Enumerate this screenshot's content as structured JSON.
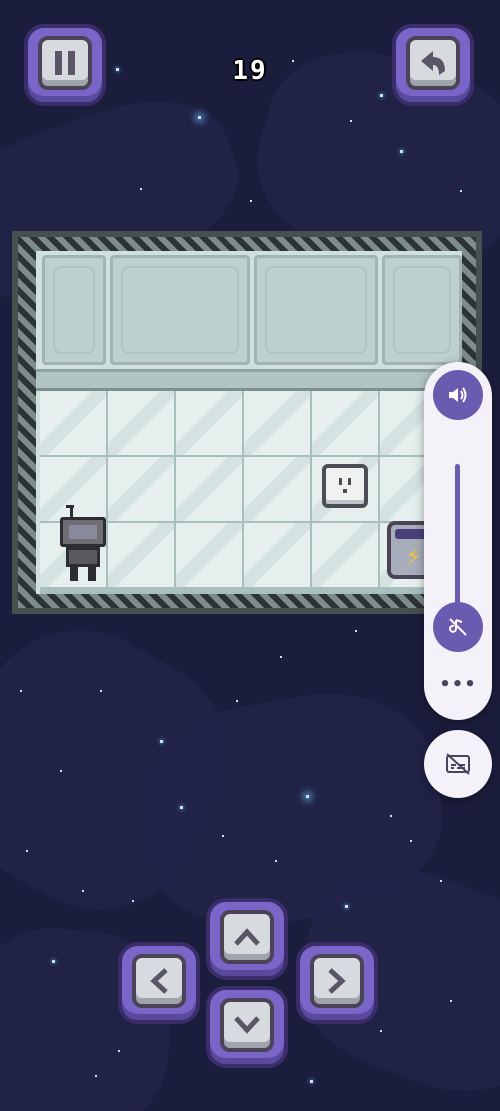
{
  "hud": {
    "score": "19",
    "pause_icon": "pause-icon",
    "undo_icon": "undo-arrow-icon"
  },
  "board": {
    "cols": 6,
    "rows": 3,
    "objects": [
      {
        "type": "robot-player",
        "icon": "robot-icon"
      },
      {
        "type": "power-outlet",
        "icon": "outlet-icon"
      },
      {
        "type": "battery-charger",
        "icon": "lightning-bolt-icon"
      }
    ]
  },
  "dpad": {
    "up_icon": "arrow-up-icon",
    "down_icon": "arrow-down-icon",
    "left_icon": "arrow-left-icon",
    "right_icon": "arrow-right-icon"
  },
  "volume_overlay": {
    "speaker_icon": "speaker-icon",
    "mute_icon": "mute-icon",
    "more_label": "•••",
    "captions_icon": "captions-off-icon"
  },
  "colors": {
    "background": "#1b1d3c",
    "button_frame": "#7a66c8",
    "board_floor": "#e4efee",
    "overlay_accent": "#6a5ab0"
  }
}
